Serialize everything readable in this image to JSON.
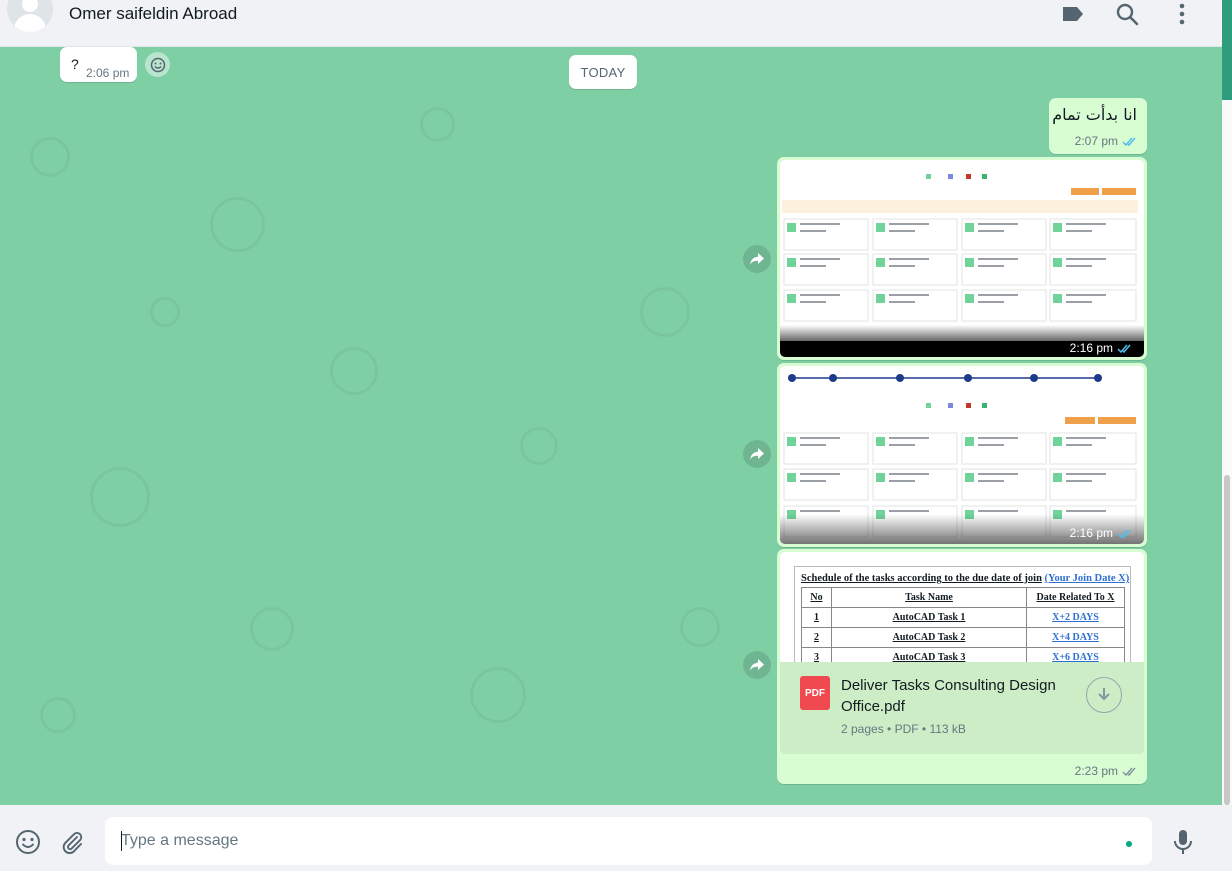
{
  "header": {
    "contact_name": "Omer saifeldin Abroad"
  },
  "chat": {
    "date_divider": "TODAY",
    "messages": [
      {
        "direction": "in",
        "text": "?",
        "time": "2:06 pm"
      },
      {
        "direction": "out",
        "text": "انا بدأت تمام",
        "time": "2:07 pm",
        "status": "read"
      },
      {
        "direction": "out",
        "type": "image",
        "time": "2:16 pm",
        "status": "read"
      },
      {
        "direction": "out",
        "type": "image",
        "time": "2:16 pm",
        "status": "read"
      },
      {
        "direction": "out",
        "type": "document",
        "time": "2:23 pm",
        "status": "delivered",
        "preview": {
          "heading": "Schedule of the tasks according to the due date of join",
          "heading_link": "(Your Join Date  X)",
          "columns": [
            "No",
            "Task Name",
            "Date Related To X"
          ],
          "rows": [
            [
              "1",
              "AutoCAD Task 1",
              "X+2 DAYS"
            ],
            [
              "2",
              "AutoCAD Task 2",
              "X+4 DAYS"
            ],
            [
              "3",
              "AutoCAD Task 3",
              "X+6 DAYS"
            ]
          ]
        },
        "file_name": "Deliver Tasks Consulting Design Office.pdf",
        "file_meta": "2 pages • PDF • 113 kB",
        "file_badge": "PDF"
      }
    ]
  },
  "composer": {
    "placeholder": "Type a message"
  },
  "colors": {
    "chat_bg": "#7fcfa5",
    "outgoing_bubble": "#d9fdd3",
    "read_tick": "#53bdeb",
    "accent": "#00a884"
  }
}
